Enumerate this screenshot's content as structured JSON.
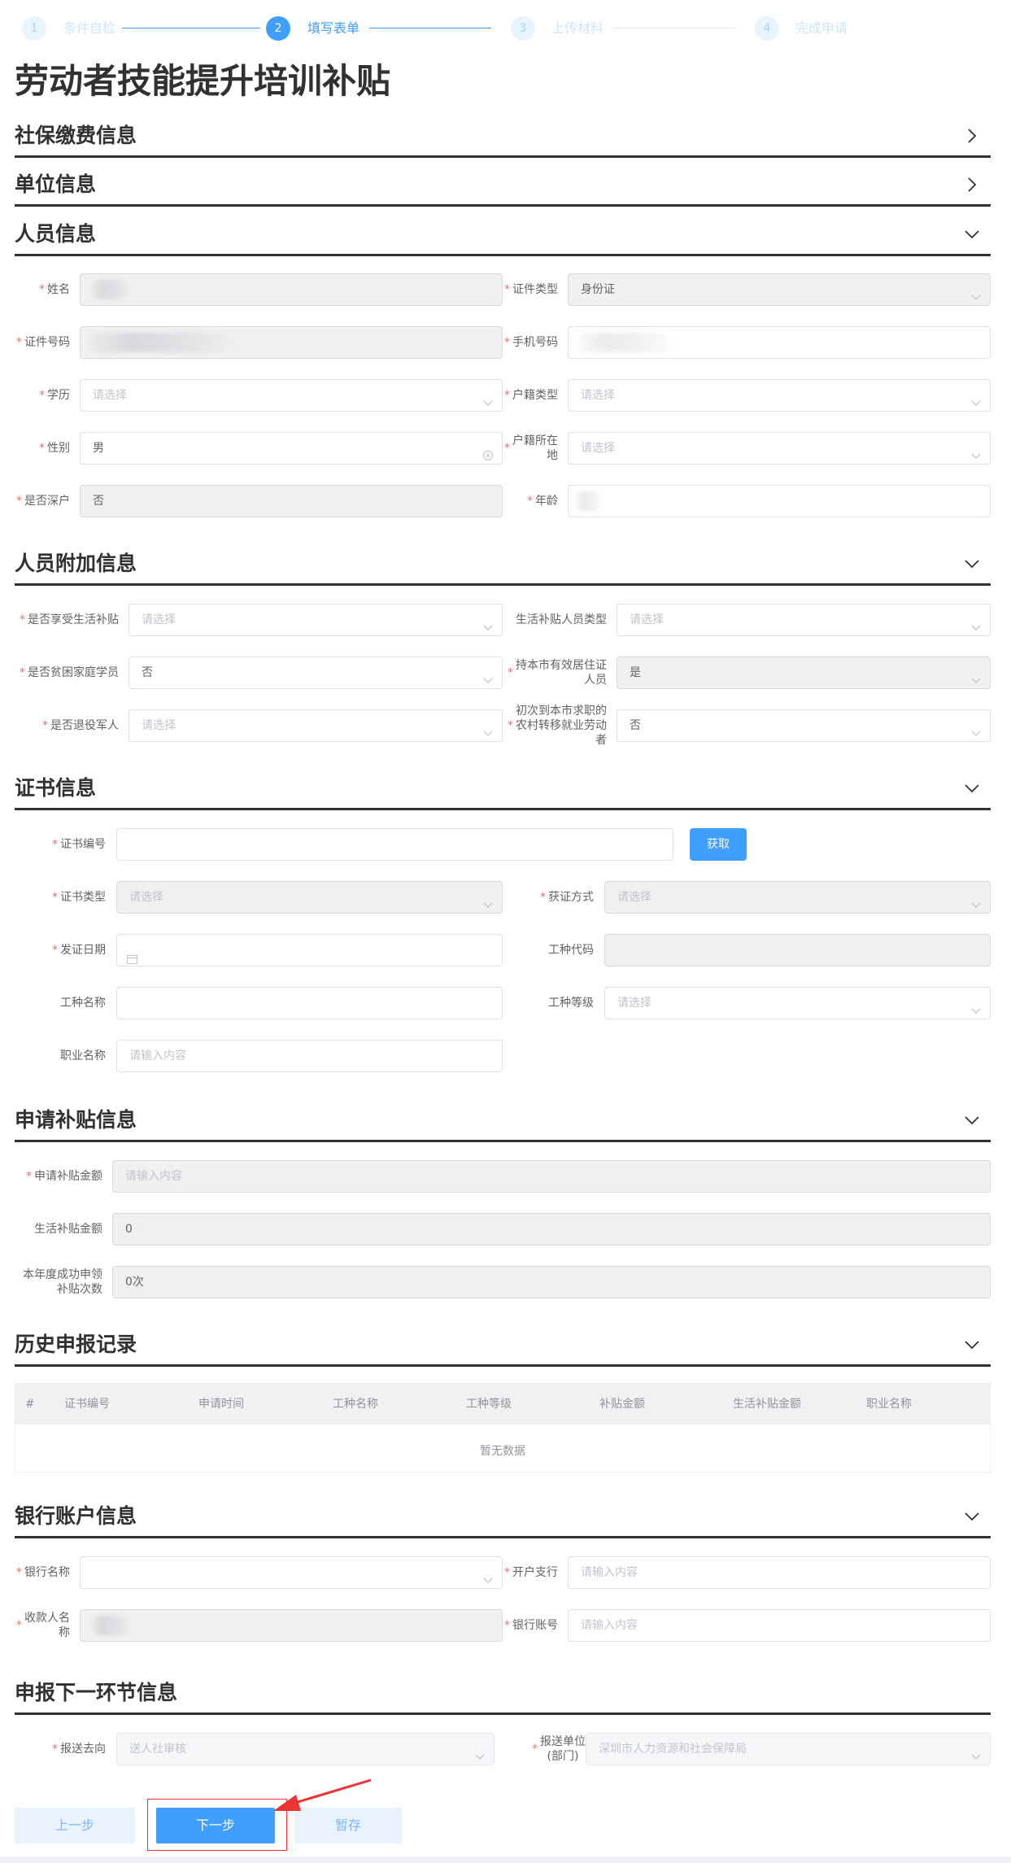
{
  "steps": [
    {
      "num": "1",
      "label": "条件自检",
      "state": "done"
    },
    {
      "num": "2",
      "label": "填写表单",
      "state": "active"
    },
    {
      "num": "3",
      "label": "上传材料",
      "state": "todo"
    },
    {
      "num": "4",
      "label": "完成申请",
      "state": "todo"
    }
  ],
  "page_title": "劳动者技能提升培训补贴",
  "sections": {
    "social": "社保缴费信息",
    "unit": "单位信息",
    "person": "人员信息",
    "extra": "人员附加信息",
    "cert": "证书信息",
    "subsidy": "申请补贴信息",
    "history": "历史申报记录",
    "bank": "银行账户信息",
    "next": "申报下一环节信息"
  },
  "person": {
    "name_label": "姓名",
    "idtype_label": "证件类型",
    "idtype_value": "身份证",
    "idnum_label": "证件号码",
    "phone_label": "手机号码",
    "edu_label": "学历",
    "edu_ph": "请选择",
    "hukou_type_label": "户籍类型",
    "hukou_type_ph": "请选择",
    "gender_label": "性别",
    "gender_value": "男",
    "hukou_loc_label_1": "户籍所在",
    "hukou_loc_label_2": "地",
    "hukou_loc_ph": "请选择",
    "sz_label": "是否深户",
    "sz_value": "否",
    "age_label": "年龄"
  },
  "extra": {
    "living_label": "是否享受生活补贴",
    "living_ph": "请选择",
    "living_type_label": "生活补贴人员类型",
    "living_type_ph": "请选择",
    "poor_label": "是否贫困家庭学员",
    "poor_value": "否",
    "resident_label_1": "持本市有效居住证",
    "resident_label_2": "人员",
    "resident_value": "是",
    "veteran_label": "是否退役军人",
    "veteran_ph": "请选择",
    "rural_label_1": "初次到本市求职的",
    "rural_label_2": "农村转移就业劳动",
    "rural_label_3": "者",
    "rural_value": "否"
  },
  "cert": {
    "num_label": "证书编号",
    "get_button": "获取",
    "type_label": "证书类型",
    "type_ph": "请选择",
    "method_label": "获证方式",
    "method_ph": "请选择",
    "date_label": "发证日期",
    "code_label": "工种代码",
    "job_name_label": "工种名称",
    "job_level_label": "工种等级",
    "job_level_ph": "请选择",
    "occupation_label": "职业名称",
    "occupation_ph": "请输入内容"
  },
  "subsidy": {
    "amount_label": "申请补贴金额",
    "amount_ph": "请输入内容",
    "living_amount_label": "生活补贴金额",
    "living_amount_value": "0",
    "count_label_1": "本年度成功申领",
    "count_label_2": "补贴次数",
    "count_value": "0次"
  },
  "history": {
    "columns": [
      "#",
      "证书编号",
      "申请时间",
      "工种名称",
      "工种等级",
      "补贴金额",
      "生活补贴金额",
      "职业名称"
    ],
    "empty": "暂无数据"
  },
  "bank": {
    "bank_label": "银行名称",
    "branch_label": "开户支行",
    "branch_ph": "请输入内容",
    "payee_label_1": "收款人名",
    "payee_label_2": "称",
    "account_label": "银行账号",
    "account_ph": "请输入内容"
  },
  "next": {
    "direction_label": "报送去向",
    "direction_value": "送人社审核",
    "unit_label_1": "报送单位",
    "unit_label_2": "(部门)",
    "unit_value": "深圳市人力资源和社会保障局"
  },
  "buttons": {
    "prev": "上一步",
    "next": "下一步",
    "save": "暂存"
  },
  "colors": {
    "primary": "#409eff",
    "required": "#f56c6c",
    "annotation": "#e33"
  }
}
